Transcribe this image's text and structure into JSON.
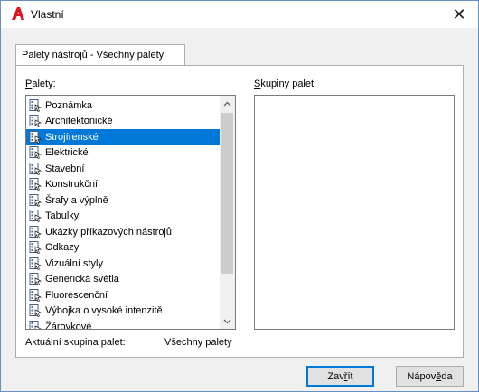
{
  "window": {
    "title": "Vlastní",
    "close_glyph": "✕",
    "accent": "#0078d7"
  },
  "tab": {
    "label": "Palety nástrojů - Všechny palety"
  },
  "palettes": {
    "label_prefix": "P",
    "label_rest": "alety:",
    "items": [
      "Poznámka",
      "Architektonické",
      "Strojírenské",
      "Elektrické",
      "Stavební",
      "Konstrukční",
      "Šrafy a výplně",
      "Tabulky",
      "Ukázky příkazových nástrojů",
      "Odkazy",
      "Vizuální styly",
      "Generická světla",
      "Fluorescenční",
      "Výbojka o vysoké intenzitě",
      "Žárovkové"
    ],
    "selected_index": 2
  },
  "groups": {
    "label_prefix": "S",
    "label_rest": "kupiny palet:"
  },
  "current_group": {
    "label": "Aktuální skupina palet:",
    "value": "Všechny palety"
  },
  "buttons": {
    "close_prefix": "Zav",
    "close_underlined": "ř",
    "close_suffix": "ít",
    "help_prefix": "Nápov",
    "help_underlined": "ě",
    "help_suffix": "da"
  },
  "icons": {
    "app": "autocad-logo-icon",
    "palette_item": "tool-palette-icon",
    "scroll_up": "chevron-up-icon",
    "scroll_down": "chevron-down-icon"
  }
}
